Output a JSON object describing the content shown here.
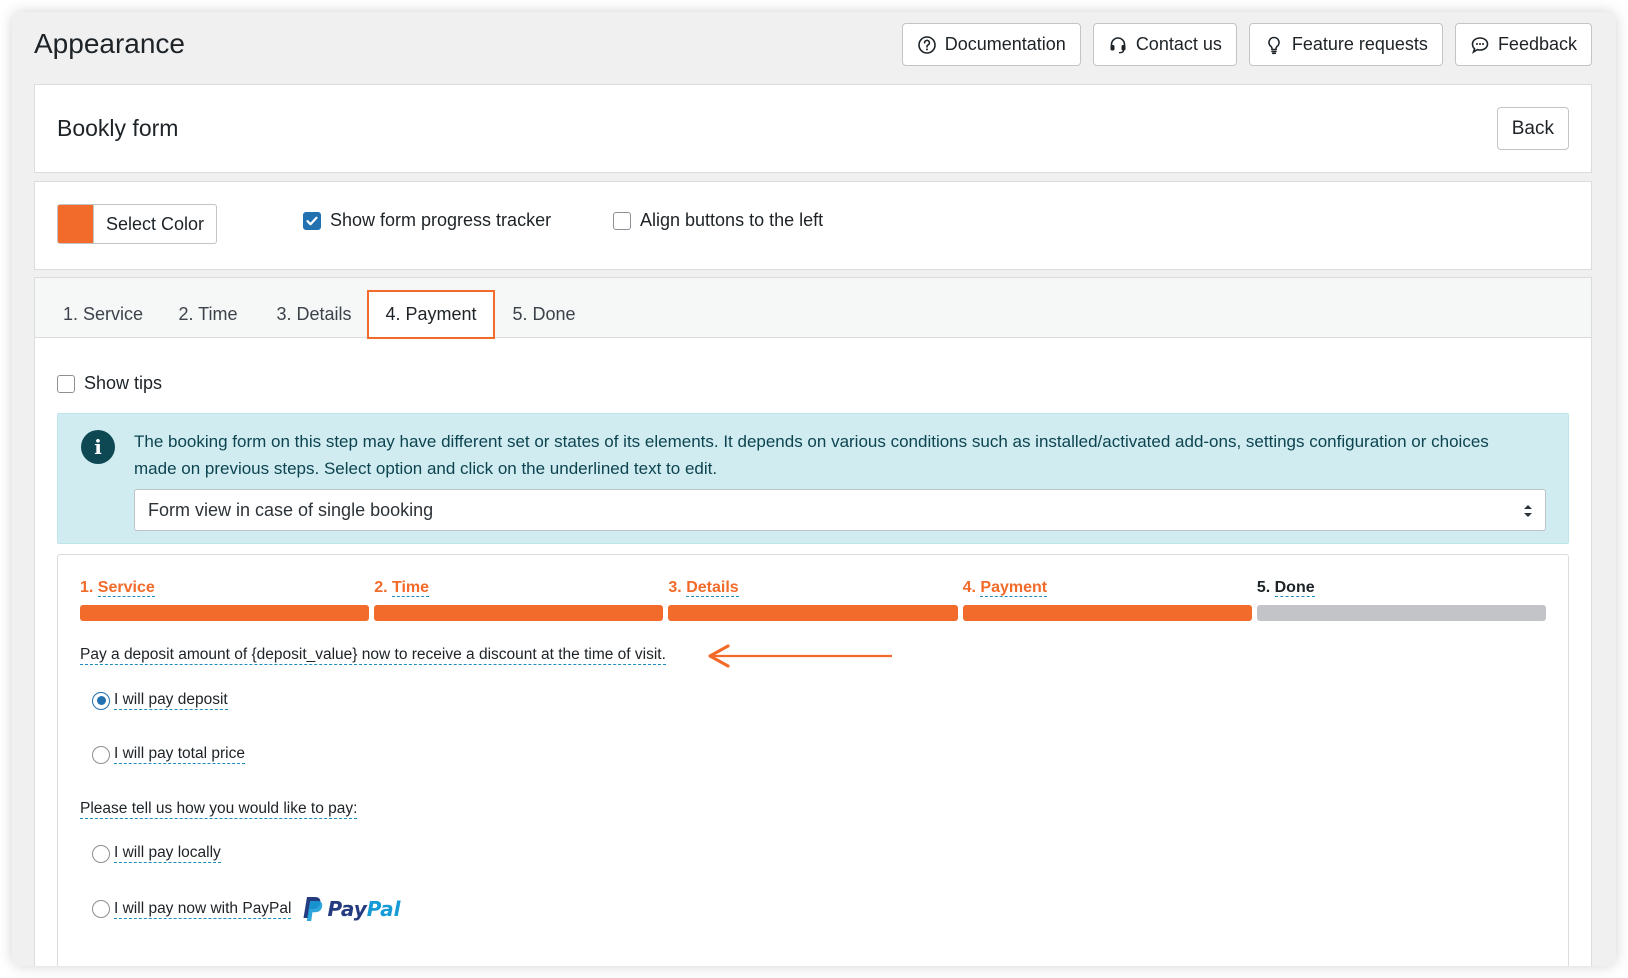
{
  "page": {
    "title": "Appearance"
  },
  "top_buttons": [
    {
      "label": "Documentation",
      "icon": "question-circle-icon"
    },
    {
      "label": "Contact us",
      "icon": "headset-icon"
    },
    {
      "label": "Feature requests",
      "icon": "lightbulb-icon"
    },
    {
      "label": "Feedback",
      "icon": "chat-bubble-icon"
    }
  ],
  "header": {
    "title": "Bookly form",
    "back_label": "Back"
  },
  "options": {
    "select_color_label": "Select Color",
    "accent_color": "#f26b2a",
    "show_progress_tracker": {
      "label": "Show form progress tracker",
      "checked": true
    },
    "align_buttons_left": {
      "label": "Align buttons to the left",
      "checked": false
    }
  },
  "tabs": [
    {
      "label": "1. Service",
      "active": false
    },
    {
      "label": "2. Time",
      "active": false
    },
    {
      "label": "3. Details",
      "active": false
    },
    {
      "label": "4. Payment",
      "active": true
    },
    {
      "label": "5. Done",
      "active": false
    }
  ],
  "show_tips": {
    "label": "Show tips",
    "checked": false
  },
  "info": {
    "text": "The booking form on this step may have different set or states of its elements. It depends on various conditions such as installed/activated add-ons, settings configuration or choices made on previous steps. Select option and click on the underlined text to edit.",
    "select_value": "Form view in case of single booking"
  },
  "preview": {
    "steps": [
      {
        "num": "1.",
        "label": "Service",
        "done": true
      },
      {
        "num": "2.",
        "label": "Time",
        "done": true
      },
      {
        "num": "3.",
        "label": "Details",
        "done": true
      },
      {
        "num": "4.",
        "label": "Payment",
        "done": true
      },
      {
        "num": "5.",
        "label": "Done",
        "done": false
      }
    ],
    "deposit_text": "Pay a deposit amount of {deposit_value} now to receive a discount at the time of visit.",
    "pay_deposit": "I will pay deposit",
    "pay_total": "I will pay total price",
    "how_to_pay": "Please tell us how you would like to pay:",
    "pay_locally": "I will pay locally",
    "pay_paypal": "I will pay now with PayPal",
    "paypal_logo_pay": "Pay",
    "paypal_logo_pal": "Pal"
  }
}
